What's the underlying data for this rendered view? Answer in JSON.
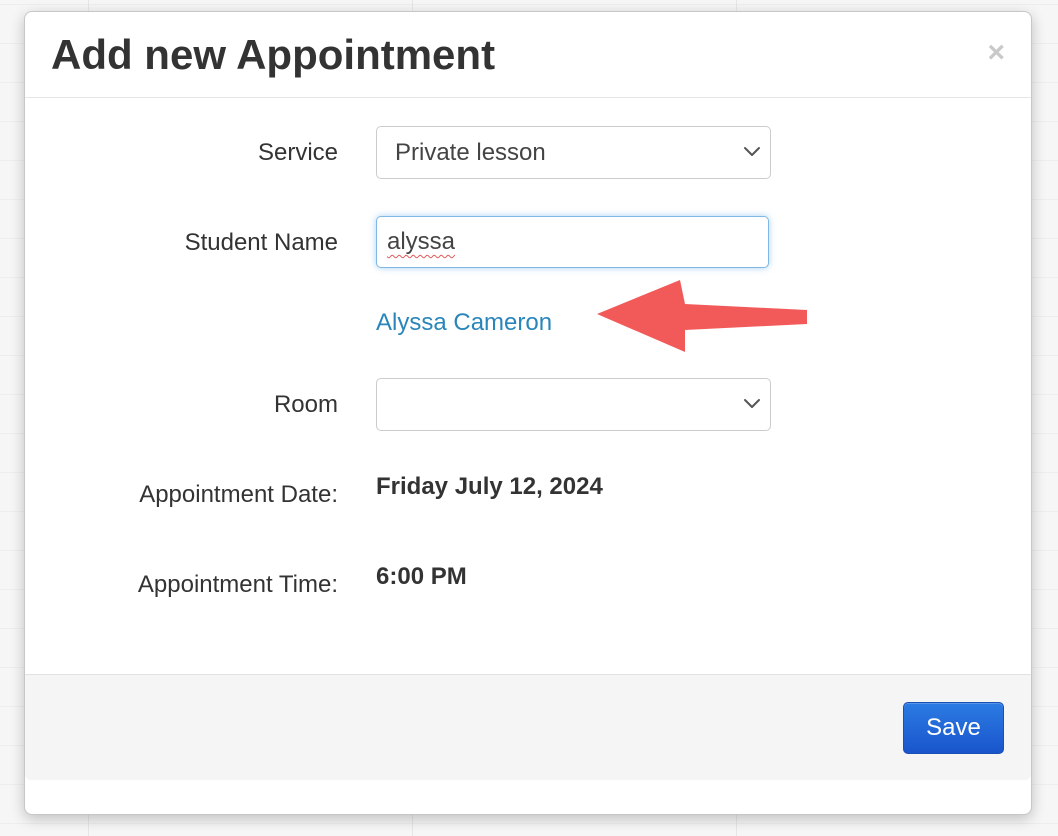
{
  "modal": {
    "title": "Add new Appointment",
    "close_symbol": "×"
  },
  "form": {
    "service": {
      "label": "Service",
      "selected": "Private lesson"
    },
    "student_name": {
      "label": "Student Name",
      "value": "alyssa",
      "suggestion": "Alyssa Cameron"
    },
    "room": {
      "label": "Room",
      "selected": ""
    },
    "appointment_date": {
      "label": "Appointment Date:",
      "value": "Friday July 12, 2024"
    },
    "appointment_time": {
      "label": "Appointment Time:",
      "value": "6:00 PM"
    }
  },
  "footer": {
    "save_label": "Save"
  },
  "icons": {
    "close": "close-icon",
    "select_chevron": "chevron-down-icon",
    "annotation": "arrow-left-icon"
  },
  "colors": {
    "link": "#2a86ba",
    "save_button": "#1f63d6",
    "annotation_arrow": "#f25a5a",
    "input_focus": "#7fb7e6"
  }
}
